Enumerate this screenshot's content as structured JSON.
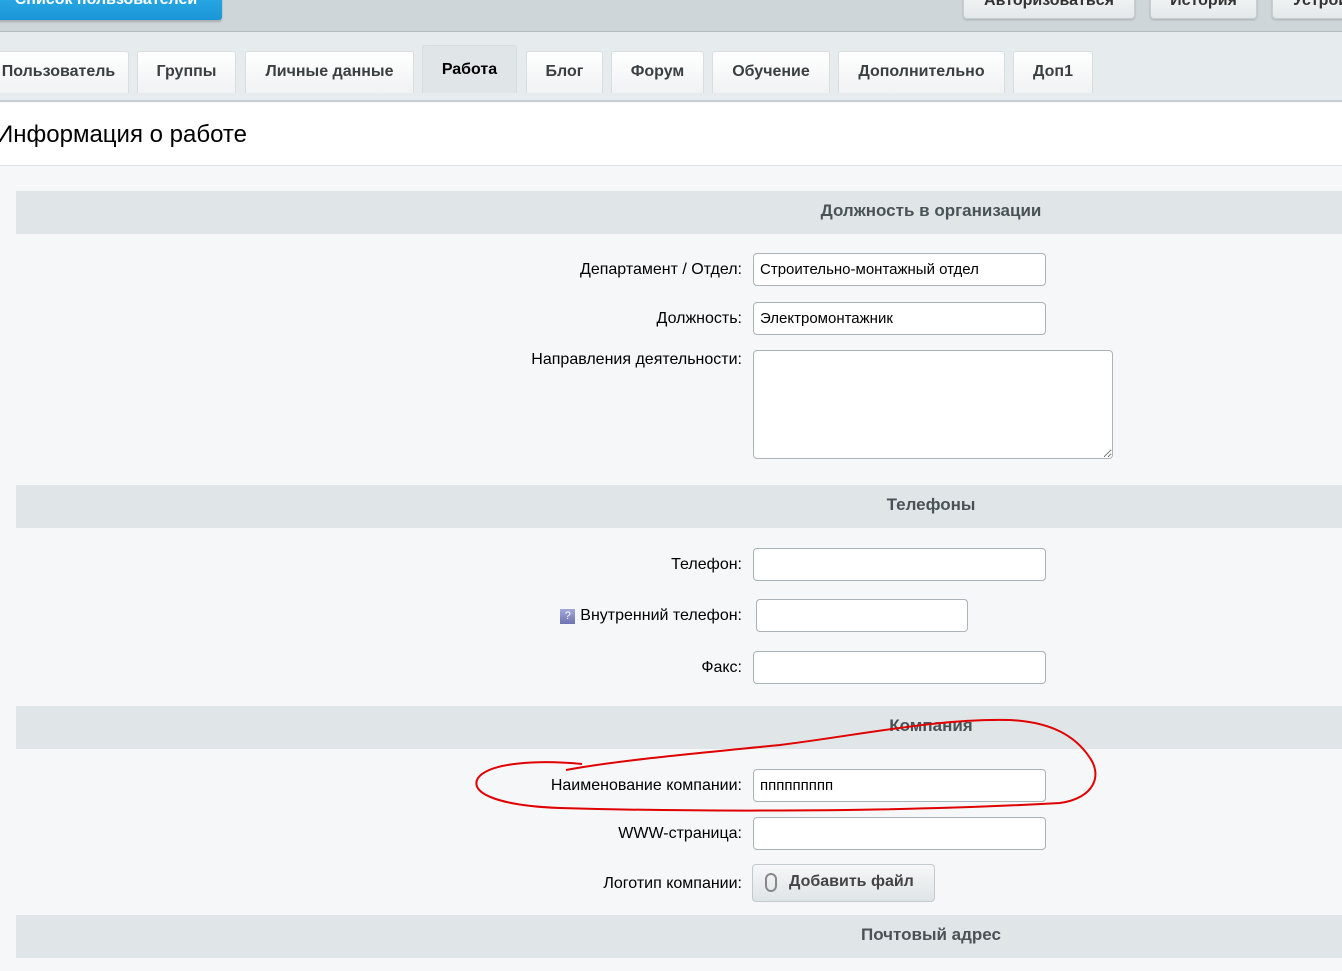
{
  "topbar": {
    "users_list": "Список пользователей",
    "authorize": "Авторизоваться",
    "history": "История",
    "devices": "Устройства"
  },
  "tabs": [
    "Пользователь",
    "Группы",
    "Личные данные",
    "Работа",
    "Блог",
    "Форум",
    "Обучение",
    "Дополнительно",
    "Доп1"
  ],
  "page_title": "Информация о работе",
  "sections": {
    "position": "Должность в организации",
    "phones": "Телефоны",
    "company": "Компания",
    "postal": "Почтовый адрес"
  },
  "fields": {
    "department": {
      "label": "Департамент / Отдел:",
      "value": "Строительно-монтажный отдел"
    },
    "job": {
      "label": "Должность:",
      "value": "Электромонтажник"
    },
    "activity": {
      "label": "Направления деятельности:",
      "value": ""
    },
    "phone": {
      "label": "Телефон:",
      "value": ""
    },
    "internal_phone": {
      "label": "Внутренний телефон:",
      "value": "",
      "help": "?"
    },
    "fax": {
      "label": "Факс:",
      "value": ""
    },
    "company_name": {
      "label": "Наименование компании:",
      "value": "ппппппппп"
    },
    "www": {
      "label": "WWW-страница:",
      "value": ""
    },
    "logo": {
      "label": "Логотип компании:",
      "button": "Добавить файл"
    }
  },
  "annotation_color": "#e00000"
}
